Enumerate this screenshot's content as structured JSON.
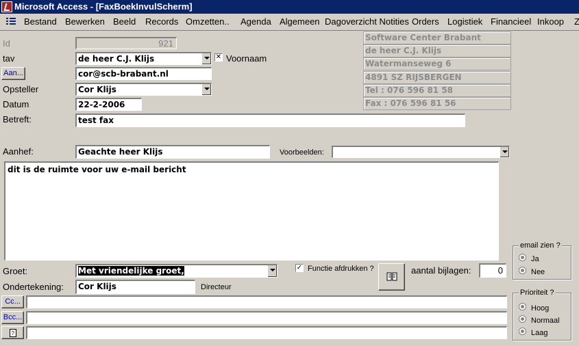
{
  "window": {
    "title": "Microsoft Access - [FaxBoekInvulScherm]"
  },
  "menu": [
    "Bestand",
    "Bewerken",
    "Beeld",
    "Records",
    "Omzetten..",
    "Agenda",
    "Algemeen",
    "Dagoverzicht Notities",
    "Orders",
    "Logistiek",
    "Financieel",
    "Inkoop",
    "Z"
  ],
  "form": {
    "id_label": "Id",
    "id_value": "921",
    "tav_label": "tav",
    "tav_value": "de heer C.J.  Klijs",
    "voornaam_label": "Voornaam",
    "aan_button": "Aan...",
    "email_value": "cor@scb-brabant.nl",
    "opsteller_label": "Opsteller",
    "opsteller_value": "Cor  Klijs",
    "datum_label": "Datum",
    "datum_value": "22-2-2006",
    "betreft_label": "Betreft:",
    "betreft_value": "test fax",
    "aanhef_label": "Aanhef:",
    "aanhef_value": "Geachte heer Klijs",
    "voorbeelden_label": "Voorbeelden:",
    "voorbeelden_value": "",
    "message_body": "dit is de ruimte voor uw e-mail bericht",
    "groet_label": "Groet:",
    "groet_value": "Met vriendelijke groet,",
    "functie_label": "Functie afdrukken ?",
    "bijlagen_label": "aantal bijlagen:",
    "bijlagen_value": "0",
    "ondertekening_label": "Ondertekening:",
    "ondertekening_value": "Cor  Klijs",
    "functie_value": "Directeur",
    "cc_button": "Cc...",
    "cc_value": "",
    "bcc_button": "Bcc...",
    "bcc_value": "",
    "extra_value": ""
  },
  "company_info": [
    "Software Center Brabant",
    "de heer C.J.  Klijs",
    "Watermanseweg 6",
    "4891 SZ RIJSBERGEN",
    "Tel : 076 596 81 58",
    "Fax : 076 596 81 56"
  ],
  "email_group": {
    "title": "email zien ?",
    "options": [
      "Ja",
      "Nee"
    ]
  },
  "priority_group": {
    "title": "Prioriteit ?",
    "options": [
      "Hoog",
      "Normaal",
      "Laag"
    ]
  },
  "icons": {
    "app": "access-icon",
    "menu": "form-menu-icon",
    "print": "book-icon",
    "extra": "note-icon"
  }
}
